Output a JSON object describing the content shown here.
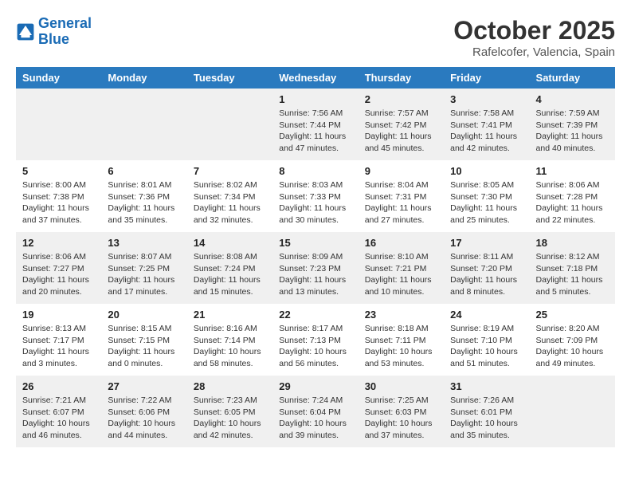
{
  "header": {
    "logo_line1": "General",
    "logo_line2": "Blue",
    "month": "October 2025",
    "location": "Rafelcofer, Valencia, Spain"
  },
  "days_of_week": [
    "Sunday",
    "Monday",
    "Tuesday",
    "Wednesday",
    "Thursday",
    "Friday",
    "Saturday"
  ],
  "weeks": [
    [
      {
        "day": "",
        "detail": ""
      },
      {
        "day": "",
        "detail": ""
      },
      {
        "day": "",
        "detail": ""
      },
      {
        "day": "1",
        "detail": "Sunrise: 7:56 AM\nSunset: 7:44 PM\nDaylight: 11 hours and 47 minutes."
      },
      {
        "day": "2",
        "detail": "Sunrise: 7:57 AM\nSunset: 7:42 PM\nDaylight: 11 hours and 45 minutes."
      },
      {
        "day": "3",
        "detail": "Sunrise: 7:58 AM\nSunset: 7:41 PM\nDaylight: 11 hours and 42 minutes."
      },
      {
        "day": "4",
        "detail": "Sunrise: 7:59 AM\nSunset: 7:39 PM\nDaylight: 11 hours and 40 minutes."
      }
    ],
    [
      {
        "day": "5",
        "detail": "Sunrise: 8:00 AM\nSunset: 7:38 PM\nDaylight: 11 hours and 37 minutes."
      },
      {
        "day": "6",
        "detail": "Sunrise: 8:01 AM\nSunset: 7:36 PM\nDaylight: 11 hours and 35 minutes."
      },
      {
        "day": "7",
        "detail": "Sunrise: 8:02 AM\nSunset: 7:34 PM\nDaylight: 11 hours and 32 minutes."
      },
      {
        "day": "8",
        "detail": "Sunrise: 8:03 AM\nSunset: 7:33 PM\nDaylight: 11 hours and 30 minutes."
      },
      {
        "day": "9",
        "detail": "Sunrise: 8:04 AM\nSunset: 7:31 PM\nDaylight: 11 hours and 27 minutes."
      },
      {
        "day": "10",
        "detail": "Sunrise: 8:05 AM\nSunset: 7:30 PM\nDaylight: 11 hours and 25 minutes."
      },
      {
        "day": "11",
        "detail": "Sunrise: 8:06 AM\nSunset: 7:28 PM\nDaylight: 11 hours and 22 minutes."
      }
    ],
    [
      {
        "day": "12",
        "detail": "Sunrise: 8:06 AM\nSunset: 7:27 PM\nDaylight: 11 hours and 20 minutes."
      },
      {
        "day": "13",
        "detail": "Sunrise: 8:07 AM\nSunset: 7:25 PM\nDaylight: 11 hours and 17 minutes."
      },
      {
        "day": "14",
        "detail": "Sunrise: 8:08 AM\nSunset: 7:24 PM\nDaylight: 11 hours and 15 minutes."
      },
      {
        "day": "15",
        "detail": "Sunrise: 8:09 AM\nSunset: 7:23 PM\nDaylight: 11 hours and 13 minutes."
      },
      {
        "day": "16",
        "detail": "Sunrise: 8:10 AM\nSunset: 7:21 PM\nDaylight: 11 hours and 10 minutes."
      },
      {
        "day": "17",
        "detail": "Sunrise: 8:11 AM\nSunset: 7:20 PM\nDaylight: 11 hours and 8 minutes."
      },
      {
        "day": "18",
        "detail": "Sunrise: 8:12 AM\nSunset: 7:18 PM\nDaylight: 11 hours and 5 minutes."
      }
    ],
    [
      {
        "day": "19",
        "detail": "Sunrise: 8:13 AM\nSunset: 7:17 PM\nDaylight: 11 hours and 3 minutes."
      },
      {
        "day": "20",
        "detail": "Sunrise: 8:15 AM\nSunset: 7:15 PM\nDaylight: 11 hours and 0 minutes."
      },
      {
        "day": "21",
        "detail": "Sunrise: 8:16 AM\nSunset: 7:14 PM\nDaylight: 10 hours and 58 minutes."
      },
      {
        "day": "22",
        "detail": "Sunrise: 8:17 AM\nSunset: 7:13 PM\nDaylight: 10 hours and 56 minutes."
      },
      {
        "day": "23",
        "detail": "Sunrise: 8:18 AM\nSunset: 7:11 PM\nDaylight: 10 hours and 53 minutes."
      },
      {
        "day": "24",
        "detail": "Sunrise: 8:19 AM\nSunset: 7:10 PM\nDaylight: 10 hours and 51 minutes."
      },
      {
        "day": "25",
        "detail": "Sunrise: 8:20 AM\nSunset: 7:09 PM\nDaylight: 10 hours and 49 minutes."
      }
    ],
    [
      {
        "day": "26",
        "detail": "Sunrise: 7:21 AM\nSunset: 6:07 PM\nDaylight: 10 hours and 46 minutes."
      },
      {
        "day": "27",
        "detail": "Sunrise: 7:22 AM\nSunset: 6:06 PM\nDaylight: 10 hours and 44 minutes."
      },
      {
        "day": "28",
        "detail": "Sunrise: 7:23 AM\nSunset: 6:05 PM\nDaylight: 10 hours and 42 minutes."
      },
      {
        "day": "29",
        "detail": "Sunrise: 7:24 AM\nSunset: 6:04 PM\nDaylight: 10 hours and 39 minutes."
      },
      {
        "day": "30",
        "detail": "Sunrise: 7:25 AM\nSunset: 6:03 PM\nDaylight: 10 hours and 37 minutes."
      },
      {
        "day": "31",
        "detail": "Sunrise: 7:26 AM\nSunset: 6:01 PM\nDaylight: 10 hours and 35 minutes."
      },
      {
        "day": "",
        "detail": ""
      }
    ]
  ]
}
